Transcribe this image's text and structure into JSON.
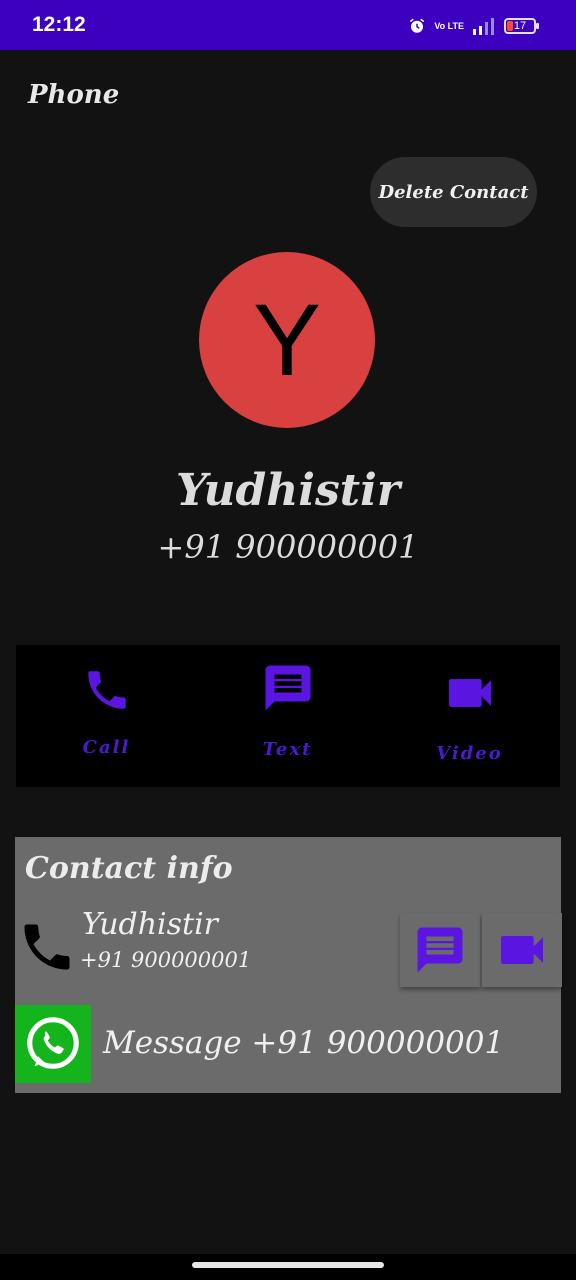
{
  "status_bar": {
    "time": "12:12",
    "network_label": "Vo LTE",
    "battery_level": "17",
    "icons": [
      "alarm-icon",
      "volte-icon",
      "signal-icon",
      "battery-icon"
    ],
    "background": "#3d00bf"
  },
  "app": {
    "title": "Phone",
    "delete_button_label": "Delete Contact"
  },
  "contact": {
    "avatar_letter": "Y",
    "avatar_color": "#d94040",
    "name": "Yudhistir",
    "number": "+91 900000001"
  },
  "actions": [
    {
      "label": "Call",
      "icon": "phone-icon"
    },
    {
      "label": "Text",
      "icon": "message-icon"
    },
    {
      "label": "Video",
      "icon": "video-camera-icon"
    }
  ],
  "accent_color": "#5b15e0",
  "contact_info": {
    "title": "Contact info",
    "name": "Yudhistir",
    "number": "+91 900000001",
    "whatsapp_text": "Message +91 900000001",
    "whatsapp_color": "#14b51c"
  }
}
